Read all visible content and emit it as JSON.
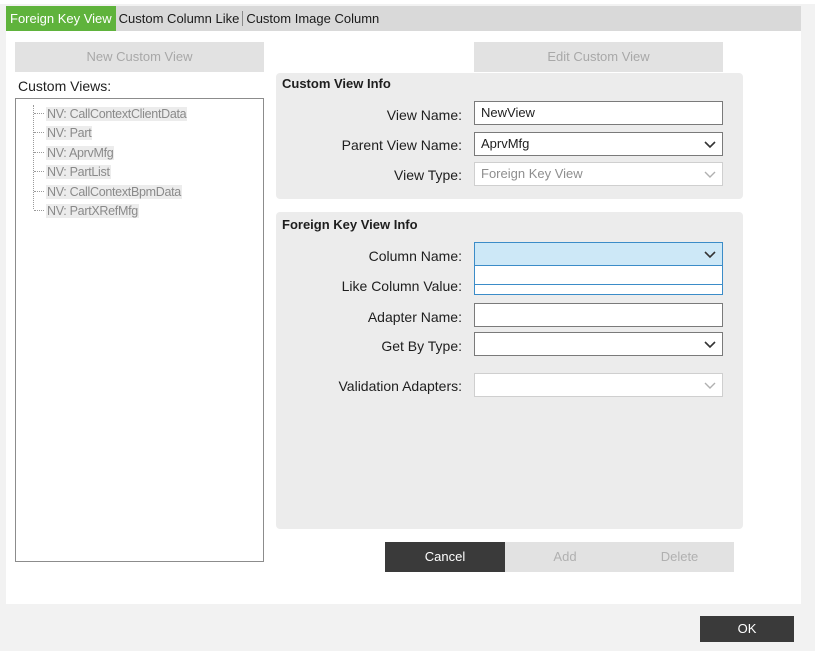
{
  "tabs": [
    {
      "label": "Foreign Key View",
      "active": true
    },
    {
      "label": "Custom Column Like",
      "active": false
    },
    {
      "label": "Custom Image Column",
      "active": false
    }
  ],
  "left": {
    "new_button": "New Custom View",
    "list_label": "Custom Views:",
    "items": [
      "NV: CallContextClientData",
      "NV: Part",
      "NV: AprvMfg",
      "NV: PartList",
      "NV: CallContextBpmData",
      "NV: PartXRefMfg"
    ]
  },
  "edit_button": "Edit Custom View",
  "custom_view_info": {
    "title": "Custom View Info",
    "view_name_label": "View Name:",
    "view_name_value": "NewView",
    "parent_view_label": "Parent View Name:",
    "parent_view_value": "AprvMfg",
    "view_type_label": "View Type:",
    "view_type_value": "Foreign Key View"
  },
  "fk_info": {
    "title": "Foreign Key View Info",
    "column_name_label": "Column Name:",
    "column_name_value": "",
    "like_column_label": "Like Column Value:",
    "like_column_value": "",
    "adapter_name_label": "Adapter Name:",
    "adapter_name_value": "",
    "get_by_type_label": "Get By Type:",
    "get_by_type_value": "",
    "validation_label": "Validation Adapters:",
    "validation_value": ""
  },
  "actions": {
    "cancel": "Cancel",
    "add": "Add",
    "delete": "Delete"
  },
  "ok": "OK",
  "colors": {
    "active_tab": "#5fb33c",
    "dark_button": "#3a3a3a",
    "focus": "#cde8f7"
  },
  "icons": {
    "dropdown": "chevron-down-icon"
  }
}
